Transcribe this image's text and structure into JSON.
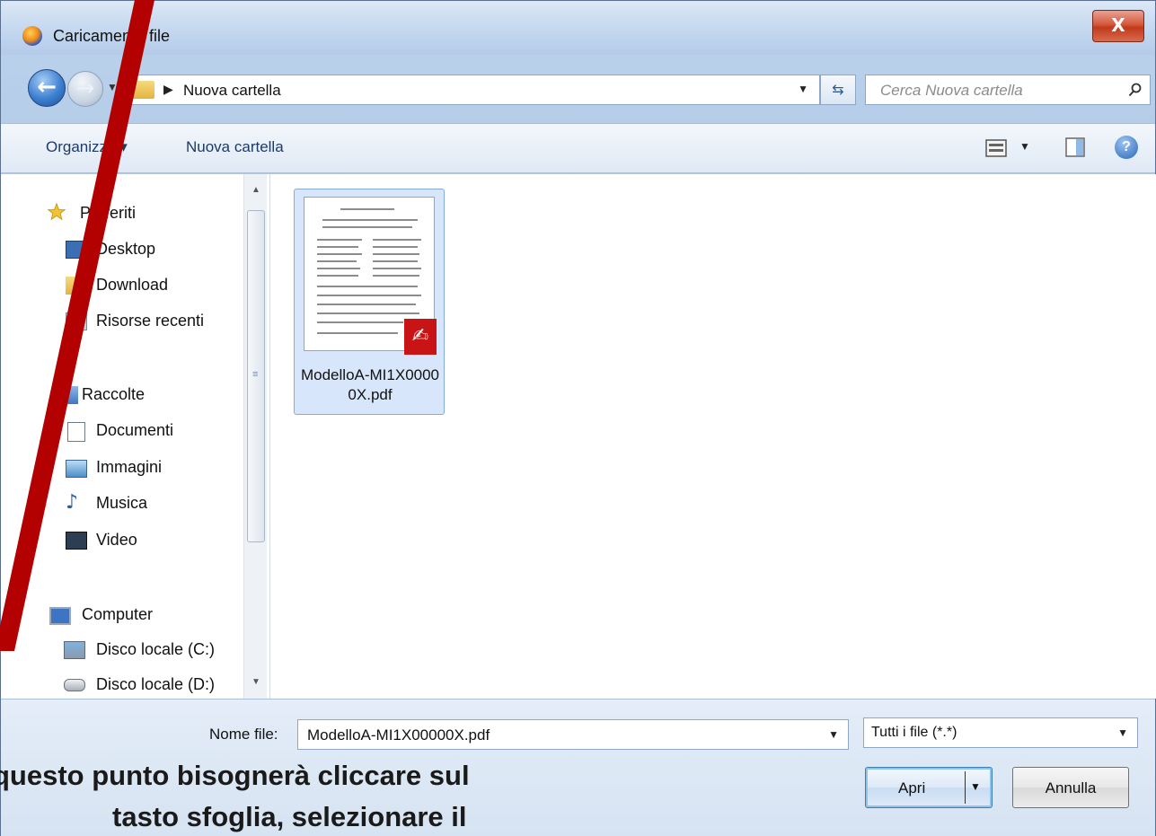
{
  "window": {
    "title": "Caricamento file",
    "close_label": "X"
  },
  "nav": {
    "back_glyph": "←",
    "forward_glyph": "→",
    "address_crumb": "Nuova cartella",
    "search_placeholder": "Cerca Nuova cartella"
  },
  "toolbar": {
    "organize_label": "Organizza ▾",
    "new_folder_label": "Nuova cartella",
    "help_label": "?"
  },
  "sidebar": {
    "items": [
      {
        "label": "Preferiti",
        "icon": "star-icon"
      },
      {
        "label": "Desktop",
        "icon": "desktop-icon"
      },
      {
        "label": "Download",
        "icon": "folder-icon"
      },
      {
        "label": "Risorse recenti",
        "icon": "recent-places-icon"
      },
      {
        "label": "Raccolte",
        "icon": "libraries-icon"
      },
      {
        "label": "Documenti",
        "icon": "document-icon"
      },
      {
        "label": "Immagini",
        "icon": "image-icon"
      },
      {
        "label": "Musica",
        "icon": "music-icon"
      },
      {
        "label": "Video",
        "icon": "video-icon"
      },
      {
        "label": "Computer",
        "icon": "computer-icon"
      },
      {
        "label": "Disco locale (C:)",
        "icon": "drive-c-icon"
      },
      {
        "label": "Disco locale (D:)",
        "icon": "drive-d-icon"
      }
    ]
  },
  "files": [
    {
      "name": "ModelloA-MI1X00000X.pdf",
      "type": "pdf",
      "selected": true
    }
  ],
  "footer": {
    "filename_label": "Nome file:",
    "filename_value": "ModelloA-MI1X00000X.pdf",
    "filetype_value": "Tutti i file (*.*)",
    "open_label": "Apri",
    "cancel_label": "Annulla"
  },
  "caption": {
    "line1": "questo punto bisognerà cliccare sul",
    "line2": "tasto sfoglia, selezionare il"
  },
  "colors": {
    "annotation_red": "#b30000",
    "selection_fill": "#d8e6fb",
    "pdf_badge": "#c81414"
  }
}
